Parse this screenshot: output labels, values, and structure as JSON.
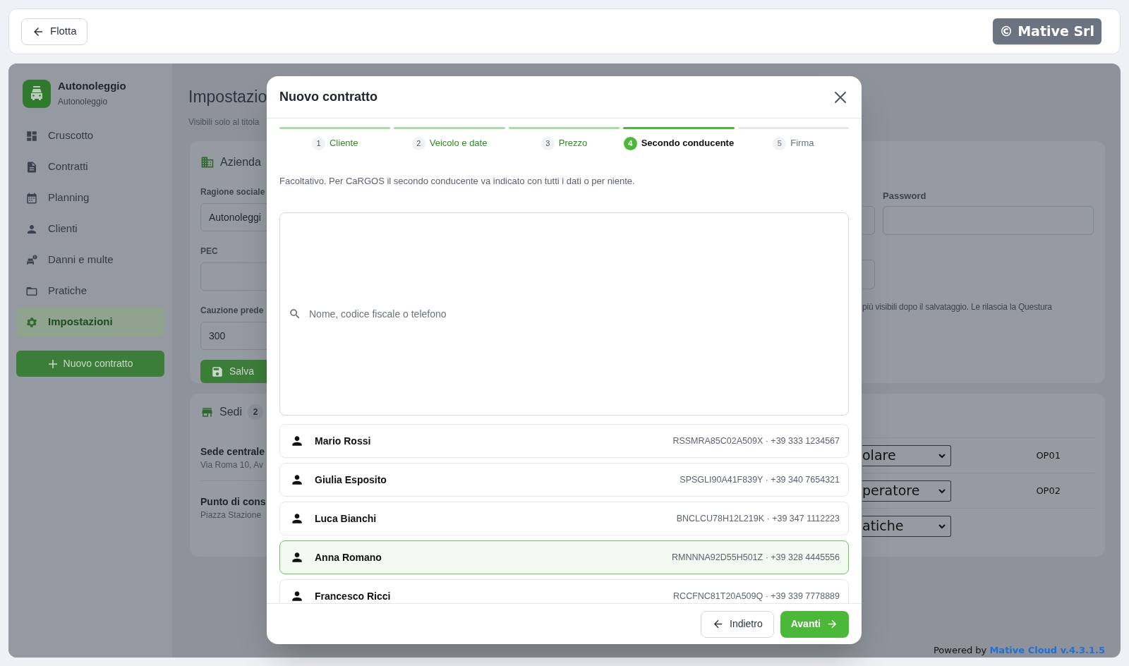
{
  "header": {
    "back_button": "Flotta",
    "badge": "© Mative Srl"
  },
  "sidebar": {
    "app_name": "Autonoleggio",
    "app_subtitle": "Autonoleggio",
    "items": [
      {
        "label": "Cruscotto",
        "selected": false
      },
      {
        "label": "Contratti",
        "selected": false
      },
      {
        "label": "Planning",
        "selected": false
      },
      {
        "label": "Clienti",
        "selected": false
      },
      {
        "label": "Danni e multe",
        "selected": false
      },
      {
        "label": "Pratiche",
        "selected": false
      },
      {
        "label": "Impostazioni",
        "selected": true
      }
    ],
    "new_button": "Nuovo contratto"
  },
  "page": {
    "title": "Impostazio",
    "subtitle": "Visibili solo al titola",
    "company_card": {
      "title": "Azienda",
      "fields": [
        {
          "label": "Ragione sociale",
          "value": "Autonoleggi"
        },
        {
          "label": "PEC"
        },
        {
          "label": "Cauzione prede",
          "value": "300"
        }
      ],
      "save_button": "Salva",
      "password_label": "Password",
      "note": "più visibili dopo il salvataggio. Le rilascia la Questura"
    },
    "locations_card": {
      "title": "Sedi",
      "count": "2",
      "locations": [
        {
          "name": "Sede centrale",
          "address": "Via Roma 10, Av"
        },
        {
          "name": "Punto di cons",
          "address": "Piazza Stazione"
        }
      ],
      "operators": [
        {
          "role": "olare",
          "code": "OP01"
        },
        {
          "role": "peratore",
          "code": "OP02"
        },
        {
          "role": "atiche"
        }
      ]
    }
  },
  "modal": {
    "title": "Nuovo contratto",
    "steps": [
      {
        "number": "1",
        "label": "Cliente",
        "selected": false
      },
      {
        "number": "2",
        "label": "Veicolo e date",
        "selected": false
      },
      {
        "number": "3",
        "label": "Prezzo",
        "selected": false
      },
      {
        "number": "4",
        "label": "Secondo conducente",
        "selected": true
      },
      {
        "number": "5",
        "label": "Firma",
        "selected": false
      }
    ],
    "note": "Facoltativo. Per CaRGOS il secondo conducente va indicato con tutti i dati o per niente.",
    "search": {
      "placeholder": "Nome, codice fiscale o telefono"
    },
    "results": [
      {
        "name": "Mario Rossi",
        "details": "RSSMRA85C02A509X · +39 333 1234567",
        "selected": false
      },
      {
        "name": "Giulia Esposito",
        "details": "SPSGLI90A41F839Y · +39 340 7654321",
        "selected": false
      },
      {
        "name": "Luca Bianchi",
        "details": "BNCLCU78H12L219K · +39 347 1112223",
        "selected": false
      },
      {
        "name": "Anna Romano",
        "details": "RMNNNA92D55H501Z · +39 328 4445556",
        "selected": true
      },
      {
        "name": "Francesco Ricci",
        "details": "RCCFNC81T20A509Q · +39 339 7778889",
        "selected": false
      }
    ],
    "back_button": "Indietro",
    "next_button": "Avanti"
  },
  "footer": {
    "prefix": "Powered by",
    "link": "Mative Cloud v.4.3.1.5"
  }
}
